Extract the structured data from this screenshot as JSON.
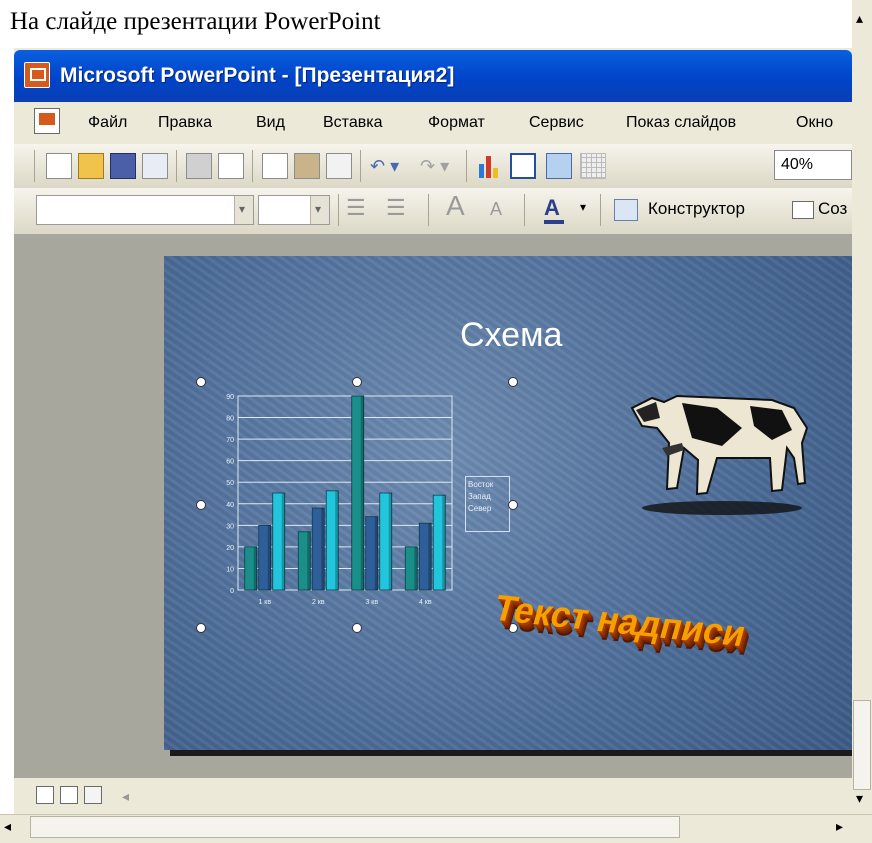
{
  "caption": "На слайде презентации PowerPoint",
  "window": {
    "title": "Microsoft PowerPoint - [Презентация2]"
  },
  "menu": {
    "items": [
      "Файл",
      "Правка",
      "Вид",
      "Вставка",
      "Формат",
      "Сервис",
      "Показ слайдов",
      "Окно"
    ]
  },
  "toolbar": {
    "zoom": "40%",
    "icons": [
      "new-icon",
      "open-icon",
      "save-icon",
      "email-icon",
      "print-icon",
      "print-preview-icon",
      "copy-icon",
      "paste-icon",
      "format-painter-icon",
      "undo-icon",
      "redo-icon",
      "chart-icon",
      "table-icon",
      "text-box-icon",
      "grid-icon"
    ]
  },
  "format_toolbar": {
    "designer_label": "Конструктор",
    "new_slide_label": "Соз"
  },
  "slide": {
    "title": "Схема",
    "wordart": "Текст надписи",
    "background_color": "#4b6b97",
    "picture": "cow-clipart"
  },
  "chart_data": {
    "type": "bar",
    "categories": [
      "1 кв",
      "2 кв",
      "3 кв",
      "4 кв"
    ],
    "series": [
      {
        "name": "Восток",
        "values": [
          20,
          27,
          90,
          20
        ],
        "color": "#1a8f8a"
      },
      {
        "name": "Запад",
        "values": [
          30,
          38,
          34,
          31
        ],
        "color": "#2f5f9a"
      },
      {
        "name": "Север",
        "values": [
          45,
          46,
          45,
          44
        ],
        "color": "#22c6dc"
      }
    ],
    "ylim": [
      0,
      90
    ],
    "yticks": [
      0,
      10,
      20,
      30,
      40,
      50,
      60,
      70,
      80,
      90
    ],
    "grid": true,
    "legend": "right"
  },
  "colors": {
    "titlebar": "#0044c8",
    "window_bg": "#ece9d8",
    "workspace": "#a8a79d"
  }
}
